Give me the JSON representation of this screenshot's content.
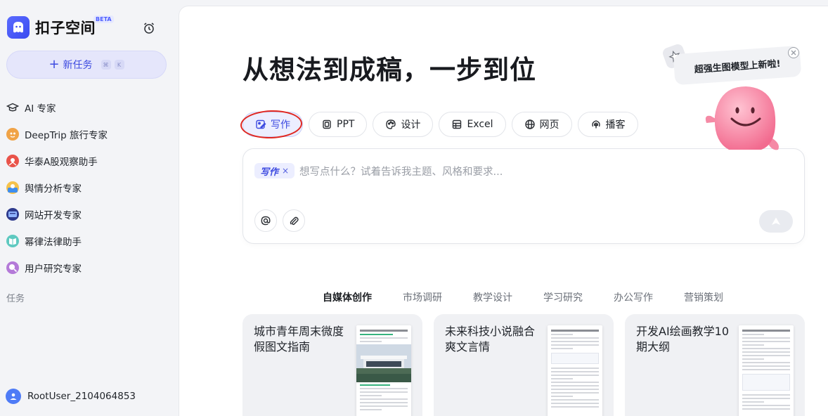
{
  "app": {
    "name": "扣子空间",
    "badge": "BETA"
  },
  "sidebar": {
    "new_task_label": "新任务",
    "shortcut": [
      "⌘",
      "K"
    ],
    "items": [
      {
        "label": "AI 专家",
        "icon": "graduation-cap-icon"
      },
      {
        "label": "DeepTrip 旅行专家",
        "icon": "deeptrip-icon"
      },
      {
        "label": "华泰A股观察助手",
        "icon": "stock-watch-icon"
      },
      {
        "label": "舆情分析专家",
        "icon": "sentiment-analysis-icon"
      },
      {
        "label": "网站开发专家",
        "icon": "web-dev-icon"
      },
      {
        "label": "幂律法律助手",
        "icon": "legal-book-icon"
      },
      {
        "label": "用户研究专家",
        "icon": "user-research-icon"
      }
    ],
    "section_label": "任务",
    "user_name": "RootUser_2104064853"
  },
  "main": {
    "headline": "从想法到成稿，一步到位",
    "modes": [
      {
        "label": "写作",
        "icon": "write-icon",
        "active": true
      },
      {
        "label": "PPT",
        "icon": "ppt-icon"
      },
      {
        "label": "设计",
        "icon": "palette-icon"
      },
      {
        "label": "Excel",
        "icon": "table-icon"
      },
      {
        "label": "网页",
        "icon": "globe-icon"
      },
      {
        "label": "播客",
        "icon": "podcast-icon"
      }
    ],
    "input": {
      "tag": "写作",
      "tag_remove": "×",
      "placeholder": "想写点什么？试着告诉我主题、风格和要求..."
    },
    "promo": {
      "text": "超强生图模型上新啦!"
    },
    "categories": [
      "自媒体创作",
      "市场调研",
      "教学设计",
      "学习研究",
      "办公写作",
      "营销策划"
    ],
    "active_category": "自媒体创作",
    "cards": [
      {
        "title": "城市青年周末微度假图文指南"
      },
      {
        "title": "未来科技小说融合爽文言情"
      },
      {
        "title": "开发AI绘画教学10期大纲"
      }
    ]
  },
  "colors": {
    "accent": "#3d4ae0",
    "accent_bg": "#eceeff",
    "annotation_red": "#e0261f"
  }
}
